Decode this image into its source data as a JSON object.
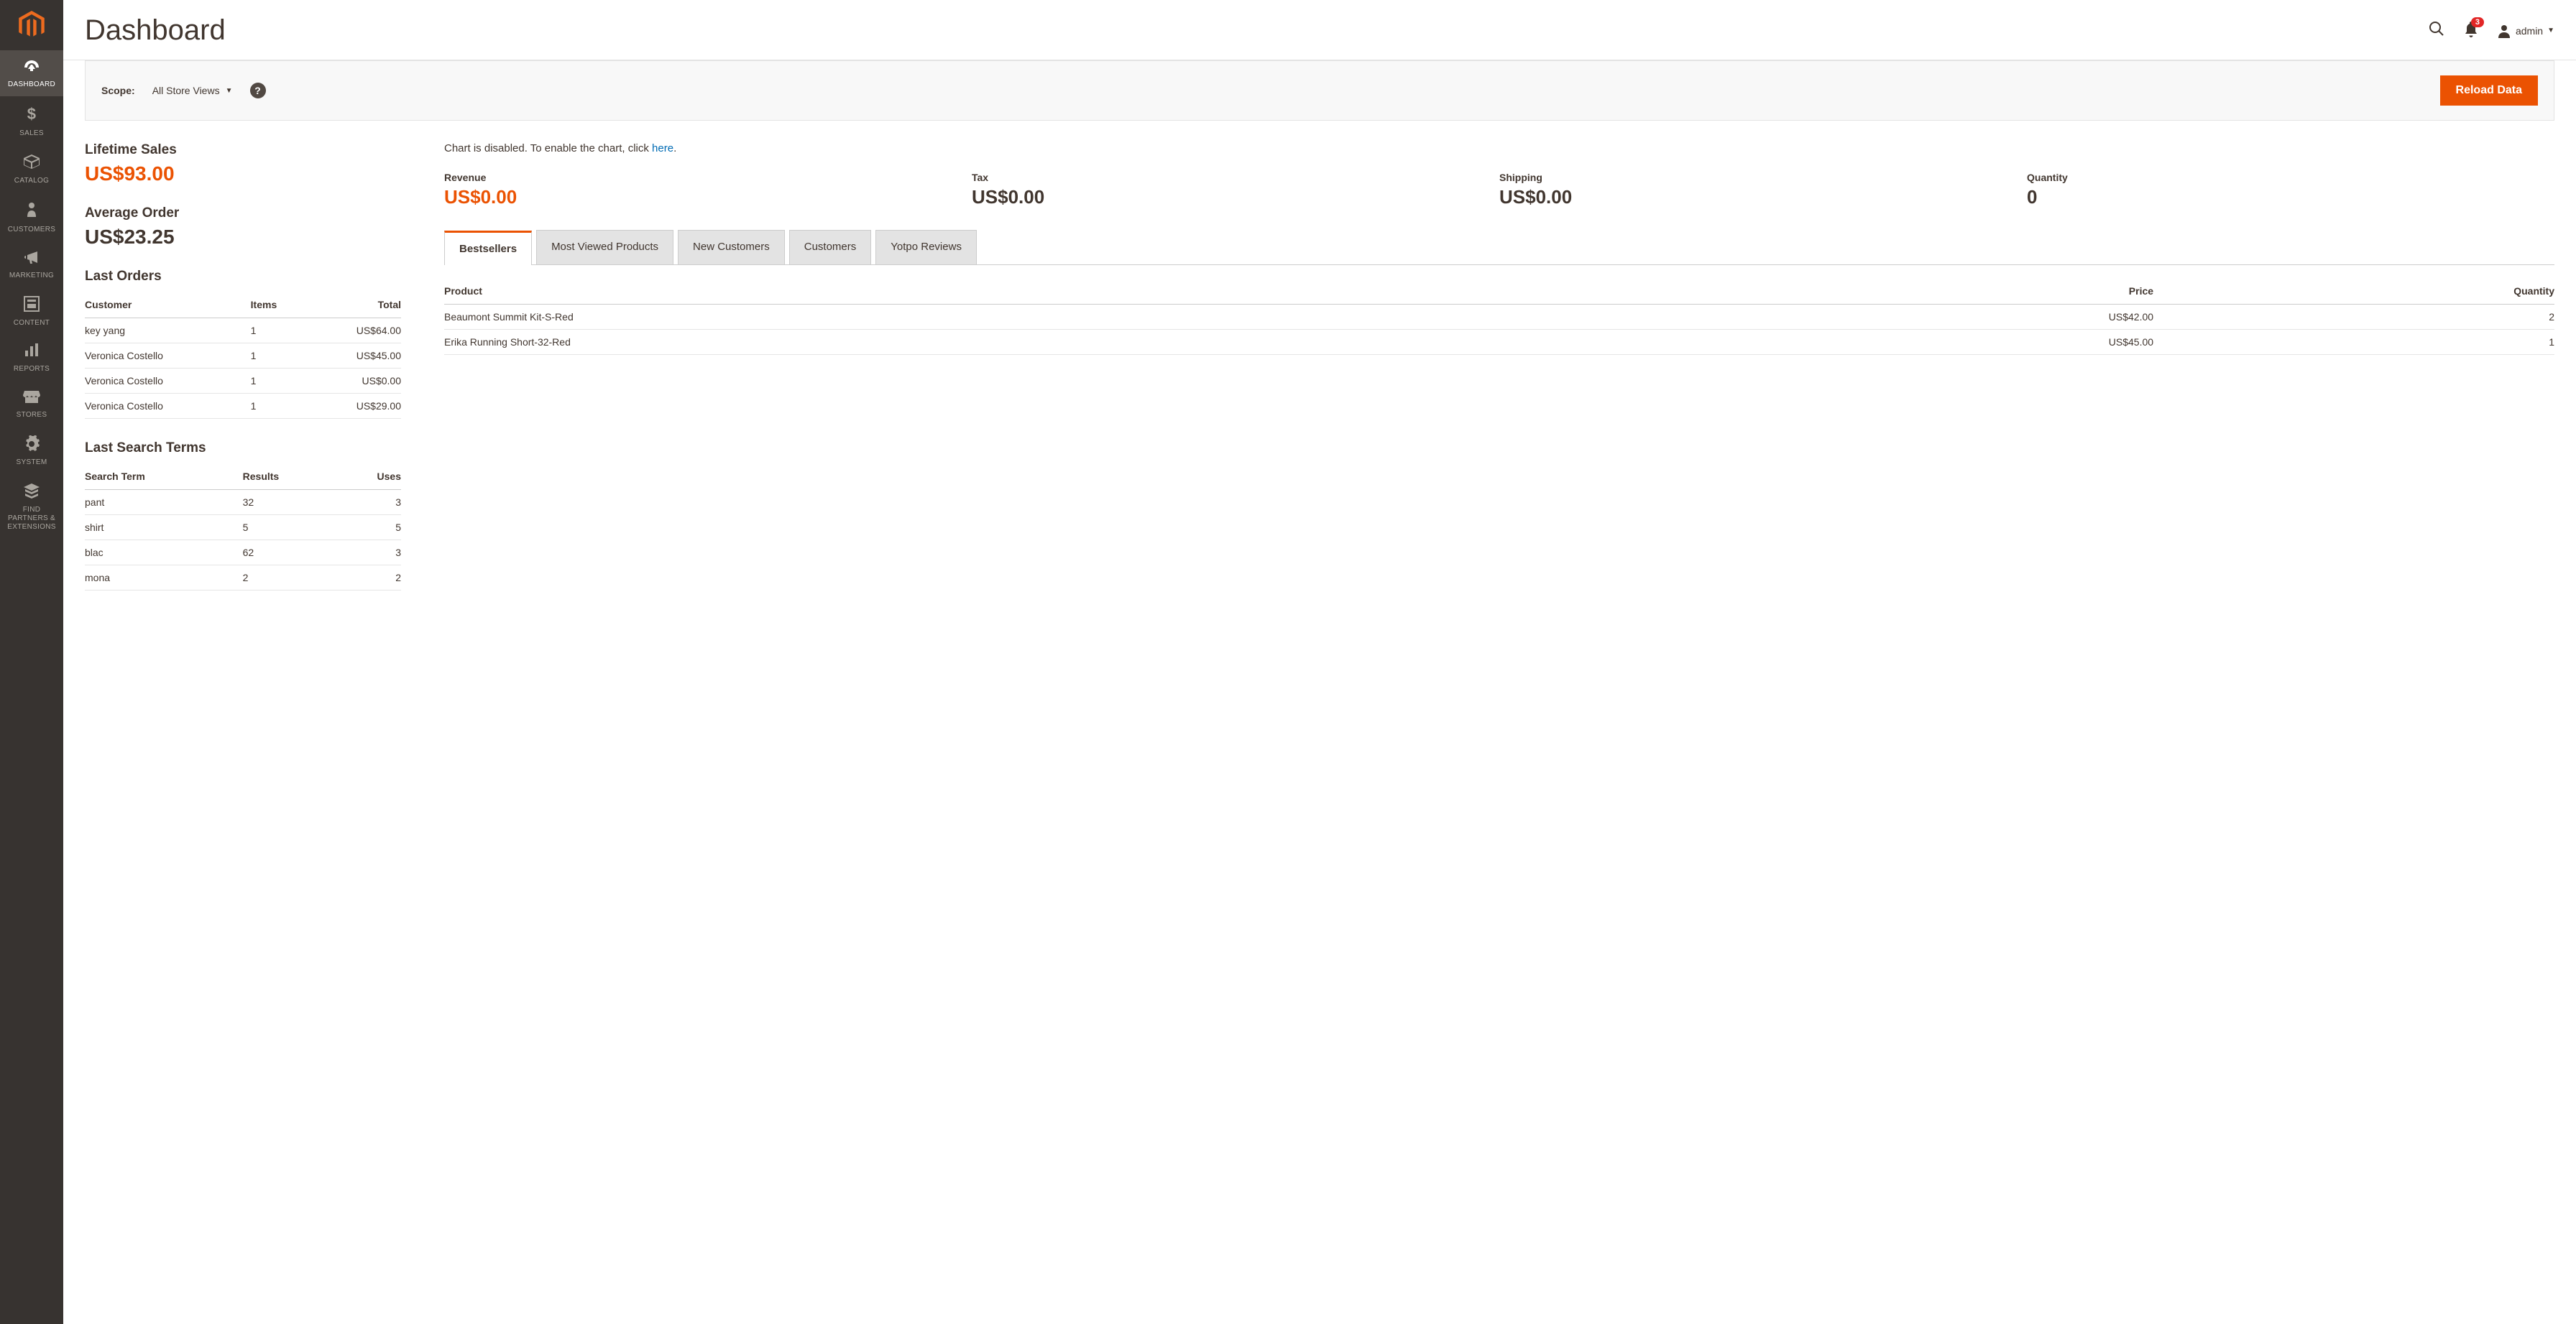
{
  "page_title": "Dashboard",
  "header": {
    "notif_count": "3",
    "admin_label": "admin"
  },
  "scope": {
    "label": "Scope:",
    "value": "All Store Views",
    "reload_label": "Reload Data"
  },
  "sidebar": {
    "items": [
      {
        "label": "DASHBOARD"
      },
      {
        "label": "SALES"
      },
      {
        "label": "CATALOG"
      },
      {
        "label": "CUSTOMERS"
      },
      {
        "label": "MARKETING"
      },
      {
        "label": "CONTENT"
      },
      {
        "label": "REPORTS"
      },
      {
        "label": "STORES"
      },
      {
        "label": "SYSTEM"
      },
      {
        "label": "FIND PARTNERS & EXTENSIONS"
      }
    ]
  },
  "lifetime_sales": {
    "title": "Lifetime Sales",
    "value": "US$93.00"
  },
  "average_order": {
    "title": "Average Order",
    "value": "US$23.25"
  },
  "last_orders": {
    "title": "Last Orders",
    "cols": {
      "c0": "Customer",
      "c1": "Items",
      "c2": "Total"
    },
    "rows": [
      {
        "c0": "key yang",
        "c1": "1",
        "c2": "US$64.00"
      },
      {
        "c0": "Veronica Costello",
        "c1": "1",
        "c2": "US$45.00"
      },
      {
        "c0": "Veronica Costello",
        "c1": "1",
        "c2": "US$0.00"
      },
      {
        "c0": "Veronica Costello",
        "c1": "1",
        "c2": "US$29.00"
      }
    ]
  },
  "last_search": {
    "title": "Last Search Terms",
    "cols": {
      "c0": "Search Term",
      "c1": "Results",
      "c2": "Uses"
    },
    "rows": [
      {
        "c0": "pant",
        "c1": "32",
        "c2": "3"
      },
      {
        "c0": "shirt",
        "c1": "5",
        "c2": "5"
      },
      {
        "c0": "blac",
        "c1": "62",
        "c2": "3"
      },
      {
        "c0": "mona",
        "c1": "2",
        "c2": "2"
      }
    ]
  },
  "chart_notice": {
    "text": "Chart is disabled. To enable the chart, click ",
    "link": "here",
    "suffix": "."
  },
  "summary": {
    "revenue": {
      "label": "Revenue",
      "value": "US$0.00"
    },
    "tax": {
      "label": "Tax",
      "value": "US$0.00"
    },
    "shipping": {
      "label": "Shipping",
      "value": "US$0.00"
    },
    "quantity": {
      "label": "Quantity",
      "value": "0"
    }
  },
  "tabs": {
    "t0": "Bestsellers",
    "t1": "Most Viewed Products",
    "t2": "New Customers",
    "t3": "Customers",
    "t4": "Yotpo Reviews"
  },
  "bestsellers": {
    "cols": {
      "c0": "Product",
      "c1": "Price",
      "c2": "Quantity"
    },
    "rows": [
      {
        "c0": "Beaumont Summit Kit-S-Red",
        "c1": "US$42.00",
        "c2": "2"
      },
      {
        "c0": "Erika Running Short-32-Red",
        "c1": "US$45.00",
        "c2": "1"
      }
    ]
  }
}
